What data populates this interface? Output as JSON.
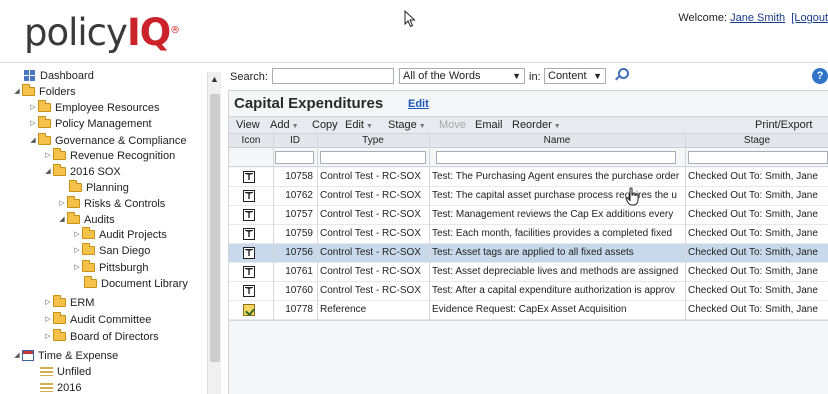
{
  "app": {
    "logo_text_a": "policy",
    "logo_text_b": "IQ",
    "logo_reg": "®",
    "welcome_prefix": "Welcome:",
    "user_name": "Jane Smith",
    "logout": "[Logout"
  },
  "sidebar": {
    "items": [
      {
        "label": "Dashboard"
      },
      {
        "label": "Folders"
      },
      {
        "label": "Employee Resources"
      },
      {
        "label": "Policy Management"
      },
      {
        "label": "Governance & Compliance"
      },
      {
        "label": "Revenue Recognition"
      },
      {
        "label": "2016 SOX"
      },
      {
        "label": "Planning"
      },
      {
        "label": "Risks & Controls"
      },
      {
        "label": "Audits"
      },
      {
        "label": "Audit Projects"
      },
      {
        "label": "San Diego"
      },
      {
        "label": "Pittsburgh"
      },
      {
        "label": "Document Library"
      },
      {
        "label": "ERM"
      },
      {
        "label": "Audit Committee"
      },
      {
        "label": "Board of Directors"
      },
      {
        "label": "Time & Expense"
      },
      {
        "label": "Unfiled"
      },
      {
        "label": "2016"
      }
    ]
  },
  "search": {
    "label": "Search:",
    "value": "",
    "mode": "All of the Words",
    "in_label": "in:",
    "scope": "Content",
    "help": "?"
  },
  "panel": {
    "title": "Capital Expenditures",
    "edit": "Edit"
  },
  "toolbar": {
    "view": "View",
    "add": "Add",
    "copy": "Copy",
    "edit": "Edit",
    "stage": "Stage",
    "move": "Move",
    "email": "Email",
    "reorder": "Reorder",
    "print_export": "Print/Export"
  },
  "grid": {
    "headers": {
      "icon": "Icon",
      "id": "ID",
      "type": "Type",
      "name": "Name",
      "stage": "Stage"
    },
    "rows": [
      {
        "icon": "T",
        "id": "10758",
        "type": "Control Test - RC-SOX",
        "name": "Test: The Purchasing Agent ensures the purchase order",
        "stage": "Checked Out To: Smith, Jane"
      },
      {
        "icon": "T",
        "id": "10762",
        "type": "Control Test - RC-SOX",
        "name": "Test: The capital asset purchase process requires the u",
        "stage": "Checked Out To: Smith, Jane"
      },
      {
        "icon": "T",
        "id": "10757",
        "type": "Control Test - RC-SOX",
        "name": "Test: Management reviews the Cap Ex additions every",
        "stage": "Checked Out To: Smith, Jane"
      },
      {
        "icon": "T",
        "id": "10759",
        "type": "Control Test - RC-SOX",
        "name": "Test: Each month, facilities provides a completed fixed",
        "stage": "Checked Out To: Smith, Jane"
      },
      {
        "icon": "T",
        "id": "10756",
        "type": "Control Test - RC-SOX",
        "name": "Test: Asset tags are applied to all fixed assets",
        "stage": "Checked Out To: Smith, Jane"
      },
      {
        "icon": "T",
        "id": "10761",
        "type": "Control Test - RC-SOX",
        "name": "Test: Asset depreciable lives and methods are assigned",
        "stage": "Checked Out To: Smith, Jane"
      },
      {
        "icon": "T",
        "id": "10760",
        "type": "Control Test - RC-SOX",
        "name": "Test: After a capital expenditure authorization is approv",
        "stage": "Checked Out To: Smith, Jane"
      },
      {
        "icon": "",
        "id": "10778",
        "type": "Reference",
        "name": "Evidence Request: CapEx Asset Acquisition",
        "stage": "Checked Out To: Smith, Jane"
      }
    ]
  }
}
